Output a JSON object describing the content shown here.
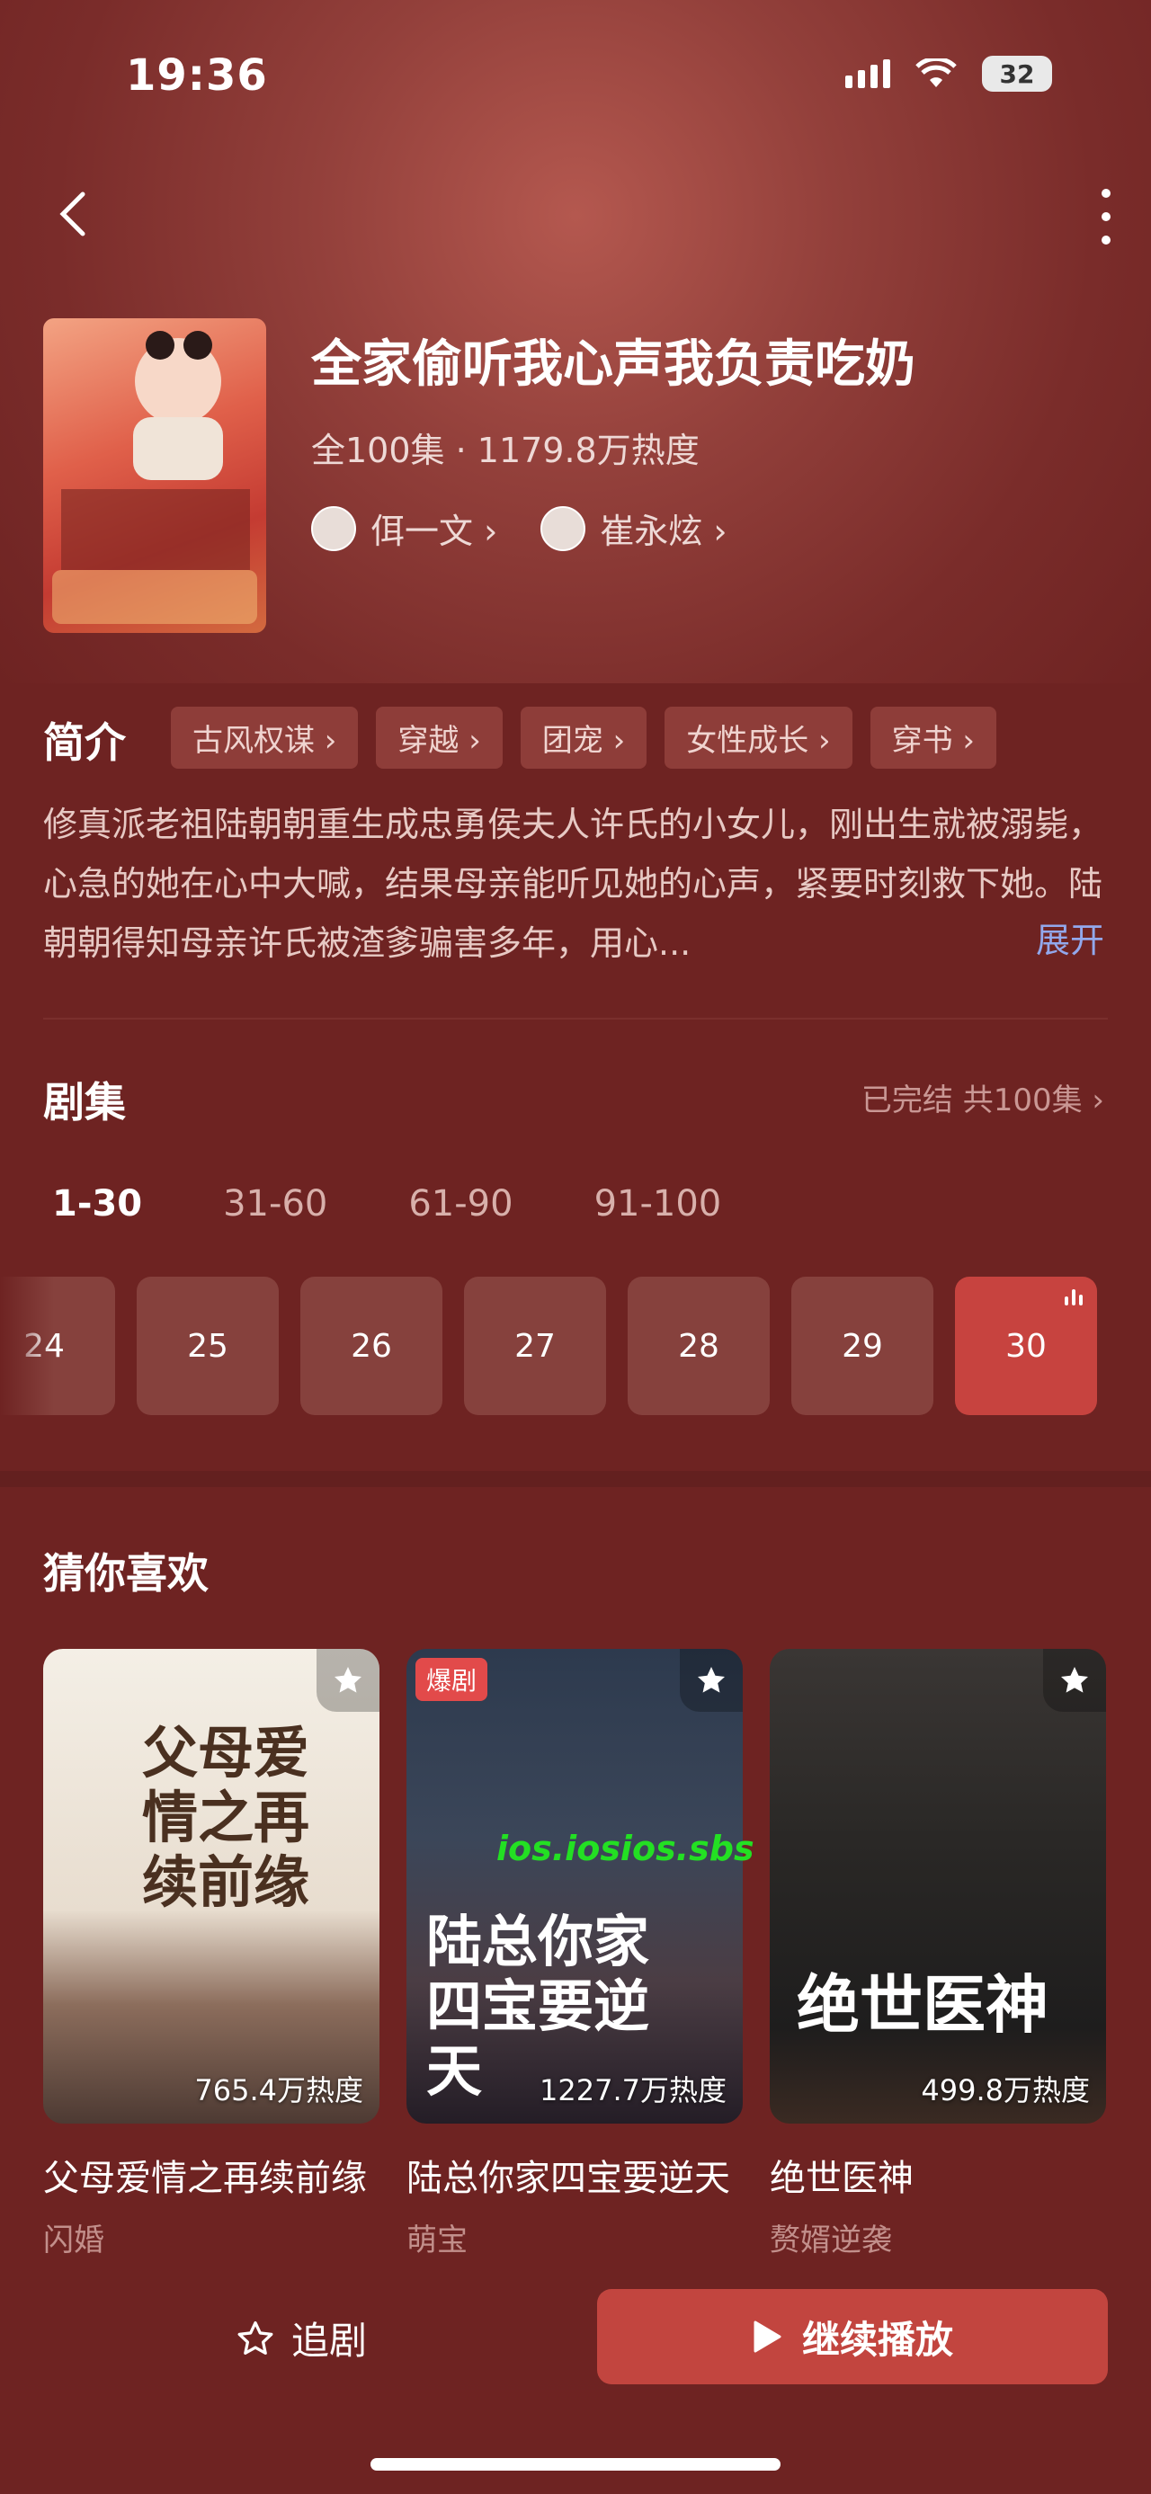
{
  "status_bar": {
    "time": "19:36",
    "battery": "32"
  },
  "drama": {
    "title": "全家偷听我心声我负责吃奶",
    "meta": "全100集 · 1179.8万热度",
    "cast": [
      "佴一文 ›",
      "崔永炫 ›"
    ]
  },
  "intro": {
    "label": "简介",
    "tags": [
      "古风权谋 ›",
      "穿越 ›",
      "团宠 ›",
      "女性成长 ›",
      "穿书 ›"
    ],
    "description": "修真派老祖陆朝朝重生成忠勇侯夫人许氏的小女儿，刚出生就被溺毙，心急的她在心中大喊，结果母亲能听见她的心声，紧要时刻救下她。陆朝朝得知母亲许氏被渣爹骗害多年，用心...",
    "expand_label": "展开"
  },
  "episodes": {
    "label": "剧集",
    "status": "已完结 共100集 ›",
    "ranges": [
      "1-30",
      "31-60",
      "61-90",
      "91-100"
    ],
    "active_range": "1-30",
    "visible": [
      "24",
      "25",
      "26",
      "27",
      "28",
      "29",
      "30"
    ],
    "current": "30"
  },
  "recommend": {
    "label": "猜你喜欢",
    "items": [
      {
        "poster_text": "父母爱情之再续前缘",
        "heat": "765.4万热度",
        "title": "父母爱情之再续前缘",
        "tag": "闪婚"
      },
      {
        "badge": "爆剧",
        "poster_text": "陆总你家四宝要逆天",
        "heat": "1227.7万热度",
        "title": "陆总你家四宝要逆天",
        "tag": "萌宝"
      },
      {
        "poster_text": "绝世医神",
        "heat": "499.8万热度",
        "title": "绝世医神",
        "tag": "赘婿逆袭"
      }
    ]
  },
  "watermark": "ios.iosios.sbs",
  "bottom_bar": {
    "follow_label": "追剧",
    "play_label": "继续播放"
  }
}
